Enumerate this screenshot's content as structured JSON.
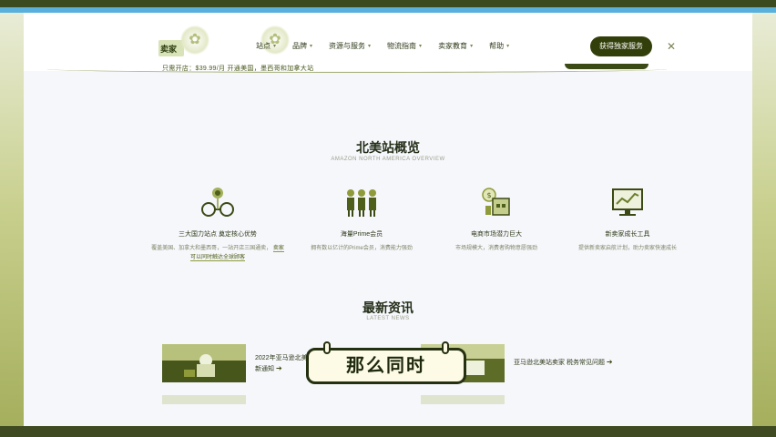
{
  "header": {
    "logo_text": "卖家",
    "nav": [
      "站点",
      "品牌",
      "资源与服务",
      "物流指南",
      "卖家教育",
      "帮助"
    ],
    "cta_label": "获得独家服务",
    "subline": "只需开店：$39.99/月  开通美国，墨西哥和加拿大站"
  },
  "overview": {
    "title": "北美站概览",
    "subtitle": "AMAZON NORTH AMERICA OVERVIEW",
    "features": [
      {
        "title": "三大国力站点 奠定核心优势",
        "desc": "覆盖美国、加拿大和墨西哥，一站开店三国通卖，",
        "desc_link": "卖家可以同时触达全球顾客"
      },
      {
        "title": "海量Prime会员",
        "desc": "拥有数以亿计的Prime会员，消费能力强劲"
      },
      {
        "title": "电商市场潜力巨大",
        "desc": "市场规模大，消费者购物意愿强劲"
      },
      {
        "title": "新卖家成长工具",
        "desc": "提供新卖家启航计划，助力卖家快速成长"
      }
    ]
  },
  "news": {
    "title": "最新资讯",
    "subtitle": "LATEST NEWS",
    "items": [
      {
        "title": "2022年亚马逊北美站 更新通知"
      },
      {
        "title": "亚马逊北美站卖家 税务常见问题"
      }
    ]
  },
  "caption": {
    "text": "那么同时"
  }
}
